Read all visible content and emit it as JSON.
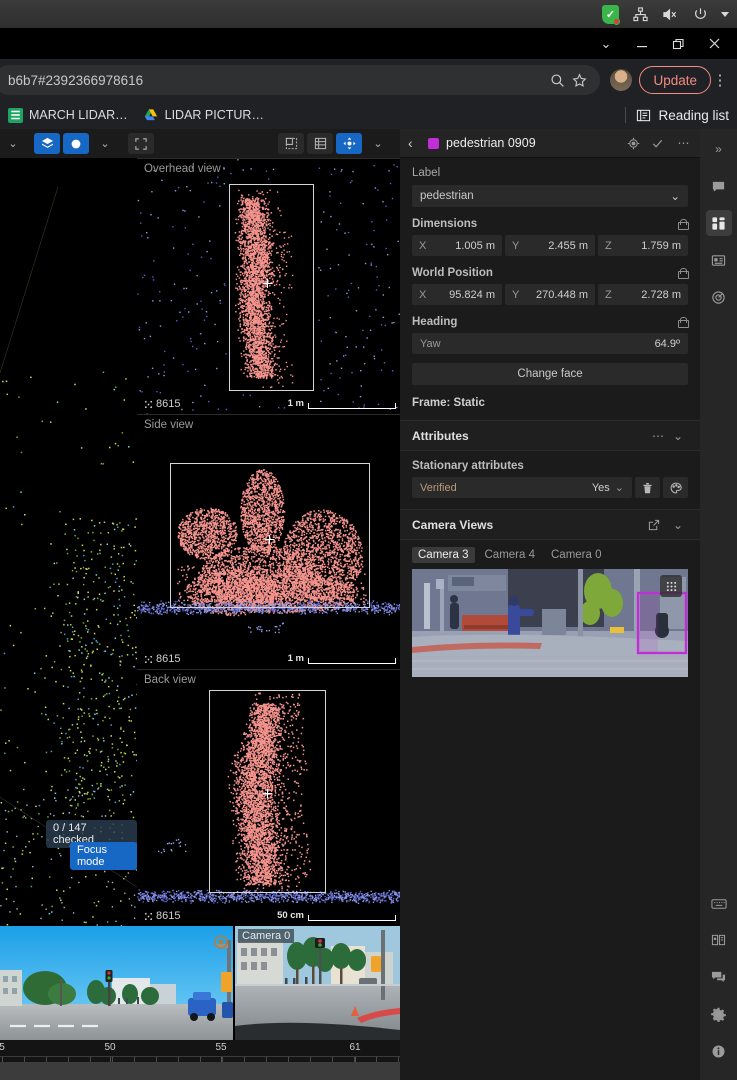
{
  "os_bar": {
    "icons": [
      "shield-check-icon",
      "network-icon",
      "volume-muted-icon",
      "power-icon",
      "caret-down-icon"
    ]
  },
  "window_controls": {
    "more": "⌄",
    "minimize": "—",
    "restore": "❐",
    "close": "✕"
  },
  "browser": {
    "url": "b6b7#2392366978616",
    "search_icon": "search-icon",
    "bookmark_icon": "star-icon",
    "update_label": "Update",
    "menu_icon": "kebab-icon",
    "bookmarks": [
      {
        "label": "MARCH LIDAR…",
        "icon": "sheets-icon",
        "glyph": "☷"
      },
      {
        "label": "LIDAR PICTUR…",
        "icon": "drive-icon",
        "glyph": "▲"
      }
    ],
    "reading_list": "Reading list",
    "reading_list_icon": "reading-list-icon"
  },
  "toolbar": {
    "buttons": [
      {
        "name": "view-dropdown",
        "glyph": "⌄",
        "active": false
      },
      {
        "name": "layers-toggle",
        "glyph": "◆",
        "active": true
      },
      {
        "name": "point-size-toggle",
        "glyph": "●",
        "active": true
      },
      {
        "name": "layers-dropdown",
        "glyph": "⌄",
        "active": false
      },
      {
        "name": "fullscreen-button",
        "glyph": "⛶",
        "active": false
      }
    ],
    "right_buttons": [
      {
        "name": "single-pane-button",
        "glyph": "◳",
        "active": false
      },
      {
        "name": "split-pane-button",
        "glyph": "▤",
        "active": false
      },
      {
        "name": "move-tool-button",
        "glyph": "✥",
        "active": true
      },
      {
        "name": "pane-dropdown",
        "glyph": "⌄",
        "active": false
      }
    ]
  },
  "panes": [
    {
      "title": "Overhead view",
      "count": "8615",
      "scale": "1 m"
    },
    {
      "title": "Side view",
      "count": "8615",
      "scale": "1 m"
    },
    {
      "title": "Back view",
      "count": "8615",
      "scale": "50 cm"
    }
  ],
  "overlays": {
    "checked_badge": "0 / 147 checked",
    "focus_badge": "Focus mode"
  },
  "camera_strip": [
    {
      "label": ""
    },
    {
      "label": "Camera 0"
    }
  ],
  "timeline": {
    "ticks": [
      "5",
      "50",
      "55",
      "61"
    ]
  },
  "inspector": {
    "back_icon": "back-arrow-icon",
    "color": "#c02fd6",
    "title": "pedestrian 0909",
    "header_icons": [
      "target-icon",
      "check-icon",
      "more-icon"
    ],
    "label_section": {
      "heading": "Label",
      "value": "pedestrian",
      "chevron": "⌄"
    },
    "dimensions": {
      "heading": "Dimensions",
      "lock_icon": "lock-icon",
      "fields": [
        {
          "key": "X",
          "value": "1.005 m"
        },
        {
          "key": "Y",
          "value": "2.455 m"
        },
        {
          "key": "Z",
          "value": "1.759 m"
        }
      ]
    },
    "world_position": {
      "heading": "World Position",
      "lock_icon": "lock-icon",
      "fields": [
        {
          "key": "X",
          "value": "95.824 m"
        },
        {
          "key": "Y",
          "value": "270.448 m"
        },
        {
          "key": "Z",
          "value": "2.728 m"
        }
      ]
    },
    "heading_section": {
      "heading": "Heading",
      "lock_icon": "lock-icon",
      "key": "Yaw",
      "value": "64.9º"
    },
    "change_face": "Change face",
    "frame": "Frame: Static",
    "attributes": {
      "heading": "Attributes",
      "more_icon": "more-icon",
      "collapse_icon": "chevron-down-icon",
      "subheading": "Stationary attributes",
      "rows": [
        {
          "key": "Verified",
          "value": "Yes",
          "chevron": "⌄",
          "delete_icon": "trash-icon",
          "palette_icon": "palette-icon"
        }
      ]
    },
    "camera_views": {
      "heading": "Camera Views",
      "popout_icon": "popout-icon",
      "collapse_icon": "chevron-down-icon",
      "tabs": [
        {
          "label": "Camera 3",
          "active": true
        },
        {
          "label": "Camera 4",
          "active": false
        },
        {
          "label": "Camera 0",
          "active": false
        }
      ],
      "grab_icon": "drag-handle-icon"
    }
  },
  "rail": {
    "top": [
      {
        "name": "expand-panel-icon",
        "glyph": "»",
        "active": false
      },
      {
        "name": "comment-icon",
        "glyph": "▤",
        "active": false
      },
      {
        "name": "grid-panel-icon",
        "glyph": "▦",
        "active": true
      },
      {
        "name": "list-card-icon",
        "glyph": "⌸",
        "active": false
      },
      {
        "name": "radar-icon",
        "glyph": "◎",
        "active": false
      }
    ],
    "bottom": [
      {
        "name": "keyboard-icon",
        "glyph": "⌨",
        "active": false
      },
      {
        "name": "manual-icon",
        "glyph": "Ὅ6",
        "active": false
      },
      {
        "name": "chat-icon",
        "glyph": "▧",
        "active": false
      },
      {
        "name": "settings-gear-icon",
        "glyph": "⚙",
        "active": false
      },
      {
        "name": "info-icon",
        "glyph": "ℹ",
        "active": false
      }
    ]
  }
}
